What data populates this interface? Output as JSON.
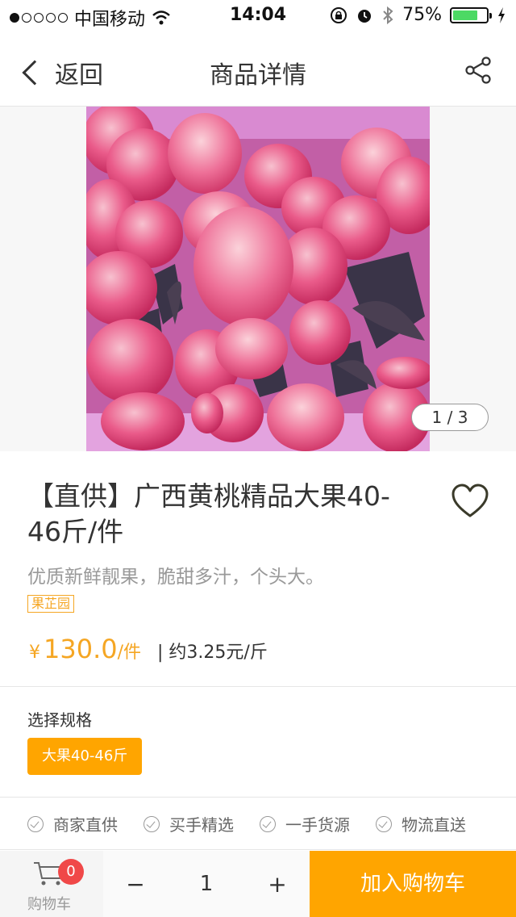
{
  "status_bar": {
    "carrier": "中国移动",
    "time": "14:04",
    "battery": "75%",
    "battery_fraction": 0.75,
    "signal_dots": [
      true,
      false,
      false,
      false,
      false
    ]
  },
  "nav": {
    "back_label": "返回",
    "title": "商品详情",
    "share_icon": "share-icon"
  },
  "gallery": {
    "page_indicator": "1 / 3"
  },
  "product": {
    "title": "【直供】广西黄桃精品大果40-46斤/件",
    "subtitle": "优质新鲜靓果，脆甜多汁，个头大。",
    "tag": "果芷园",
    "currency": "¥",
    "price": "130.0",
    "unit": "/件",
    "price_per_jin": "| 约3.25元/斤"
  },
  "spec": {
    "label": "选择规格",
    "selected": "大果40-46斤"
  },
  "guarantees": [
    "商家直供",
    "买手精选",
    "一手货源",
    "物流直送"
  ],
  "bottom_bar": {
    "cart_label": "购物车",
    "cart_count": "0",
    "minus": "−",
    "quantity": "1",
    "plus": "+",
    "add_to_cart": "加入购物车"
  },
  "colors": {
    "accent": "#ffa500",
    "badge": "#f04848",
    "battery": "#4cd964"
  }
}
